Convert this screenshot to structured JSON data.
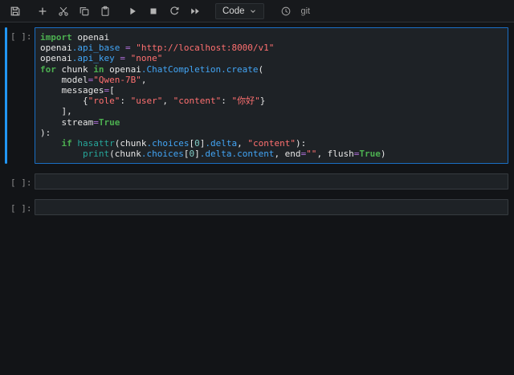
{
  "toolbar": {
    "mode_label": "Code",
    "git_label": "git",
    "buttons": [
      "save",
      "insert-cell-below",
      "cut",
      "copy",
      "paste",
      "run",
      "interrupt-kernel",
      "restart-kernel",
      "restart-and-run-all",
      "cell-type-dropdown",
      "kernel-clock"
    ]
  },
  "colors": {
    "accent": "#2196f3",
    "page_bg": "#121417",
    "editor_bg": "#1e2226",
    "keyword": "#4caf50",
    "string": "#ff7070",
    "operator": "#b06fd8",
    "property": "#42a5f5",
    "number": "#80cbc4",
    "builtin": "#26a69a",
    "prompt": "#8c8c8c"
  },
  "cells": [
    {
      "prompt": "[ ]:",
      "type": "code",
      "active": true,
      "lines": [
        [
          {
            "t": "import",
            "c": "kw"
          },
          {
            "t": " openai",
            "c": "pl"
          }
        ],
        [
          {
            "t": "openai",
            "c": "pl"
          },
          {
            "t": ".api_base",
            "c": "prop"
          },
          {
            "t": " ",
            "c": "pl"
          },
          {
            "t": "=",
            "c": "op"
          },
          {
            "t": " ",
            "c": "pl"
          },
          {
            "t": "\"http://localhost:8000/v1\"",
            "c": "str"
          }
        ],
        [
          {
            "t": "openai",
            "c": "pl"
          },
          {
            "t": ".api_key",
            "c": "prop"
          },
          {
            "t": " ",
            "c": "pl"
          },
          {
            "t": "=",
            "c": "op"
          },
          {
            "t": " ",
            "c": "pl"
          },
          {
            "t": "\"none\"",
            "c": "str"
          }
        ],
        [
          {
            "t": "for",
            "c": "kw"
          },
          {
            "t": " chunk ",
            "c": "pl"
          },
          {
            "t": "in",
            "c": "kw"
          },
          {
            "t": " openai",
            "c": "pl"
          },
          {
            "t": ".ChatCompletion.create",
            "c": "prop"
          },
          {
            "t": "(",
            "c": "pl"
          }
        ],
        [
          {
            "t": "    model",
            "c": "pl"
          },
          {
            "t": "=",
            "c": "op"
          },
          {
            "t": "\"Qwen-7B\"",
            "c": "str"
          },
          {
            "t": ",",
            "c": "pl"
          }
        ],
        [
          {
            "t": "    messages",
            "c": "pl"
          },
          {
            "t": "=",
            "c": "op"
          },
          {
            "t": "[",
            "c": "pl"
          }
        ],
        [
          {
            "t": "        {",
            "c": "pl"
          },
          {
            "t": "\"role\"",
            "c": "str"
          },
          {
            "t": ": ",
            "c": "pl"
          },
          {
            "t": "\"user\"",
            "c": "str"
          },
          {
            "t": ", ",
            "c": "pl"
          },
          {
            "t": "\"content\"",
            "c": "str"
          },
          {
            "t": ": ",
            "c": "pl"
          },
          {
            "t": "\"你好\"",
            "c": "str"
          },
          {
            "t": "}",
            "c": "pl"
          }
        ],
        [
          {
            "t": "    ],",
            "c": "pl"
          }
        ],
        [
          {
            "t": "    stream",
            "c": "pl"
          },
          {
            "t": "=",
            "c": "op"
          },
          {
            "t": "True",
            "c": "kw"
          }
        ],
        [
          {
            "t": "):",
            "c": "pl"
          }
        ],
        [
          {
            "t": "    ",
            "c": "pl"
          },
          {
            "t": "if",
            "c": "kw"
          },
          {
            "t": " ",
            "c": "pl"
          },
          {
            "t": "hasattr",
            "c": "bi"
          },
          {
            "t": "(chunk",
            "c": "pl"
          },
          {
            "t": ".choices",
            "c": "prop"
          },
          {
            "t": "[",
            "c": "pl"
          },
          {
            "t": "0",
            "c": "num"
          },
          {
            "t": "]",
            "c": "pl"
          },
          {
            "t": ".delta",
            "c": "prop"
          },
          {
            "t": ", ",
            "c": "pl"
          },
          {
            "t": "\"content\"",
            "c": "str"
          },
          {
            "t": "):",
            "c": "pl"
          }
        ],
        [
          {
            "t": "        ",
            "c": "pl"
          },
          {
            "t": "print",
            "c": "bi"
          },
          {
            "t": "(chunk",
            "c": "pl"
          },
          {
            "t": ".choices",
            "c": "prop"
          },
          {
            "t": "[",
            "c": "pl"
          },
          {
            "t": "0",
            "c": "num"
          },
          {
            "t": "]",
            "c": "pl"
          },
          {
            "t": ".delta.content",
            "c": "prop"
          },
          {
            "t": ", end",
            "c": "pl"
          },
          {
            "t": "=",
            "c": "op"
          },
          {
            "t": "\"\"",
            "c": "str"
          },
          {
            "t": ", flush",
            "c": "pl"
          },
          {
            "t": "=",
            "c": "op"
          },
          {
            "t": "True",
            "c": "kw"
          },
          {
            "t": ")",
            "c": "pl"
          }
        ]
      ]
    },
    {
      "prompt": "[ ]:",
      "type": "code",
      "active": false,
      "lines": []
    },
    {
      "prompt": "[ ]:",
      "type": "code",
      "active": false,
      "lines": []
    }
  ]
}
